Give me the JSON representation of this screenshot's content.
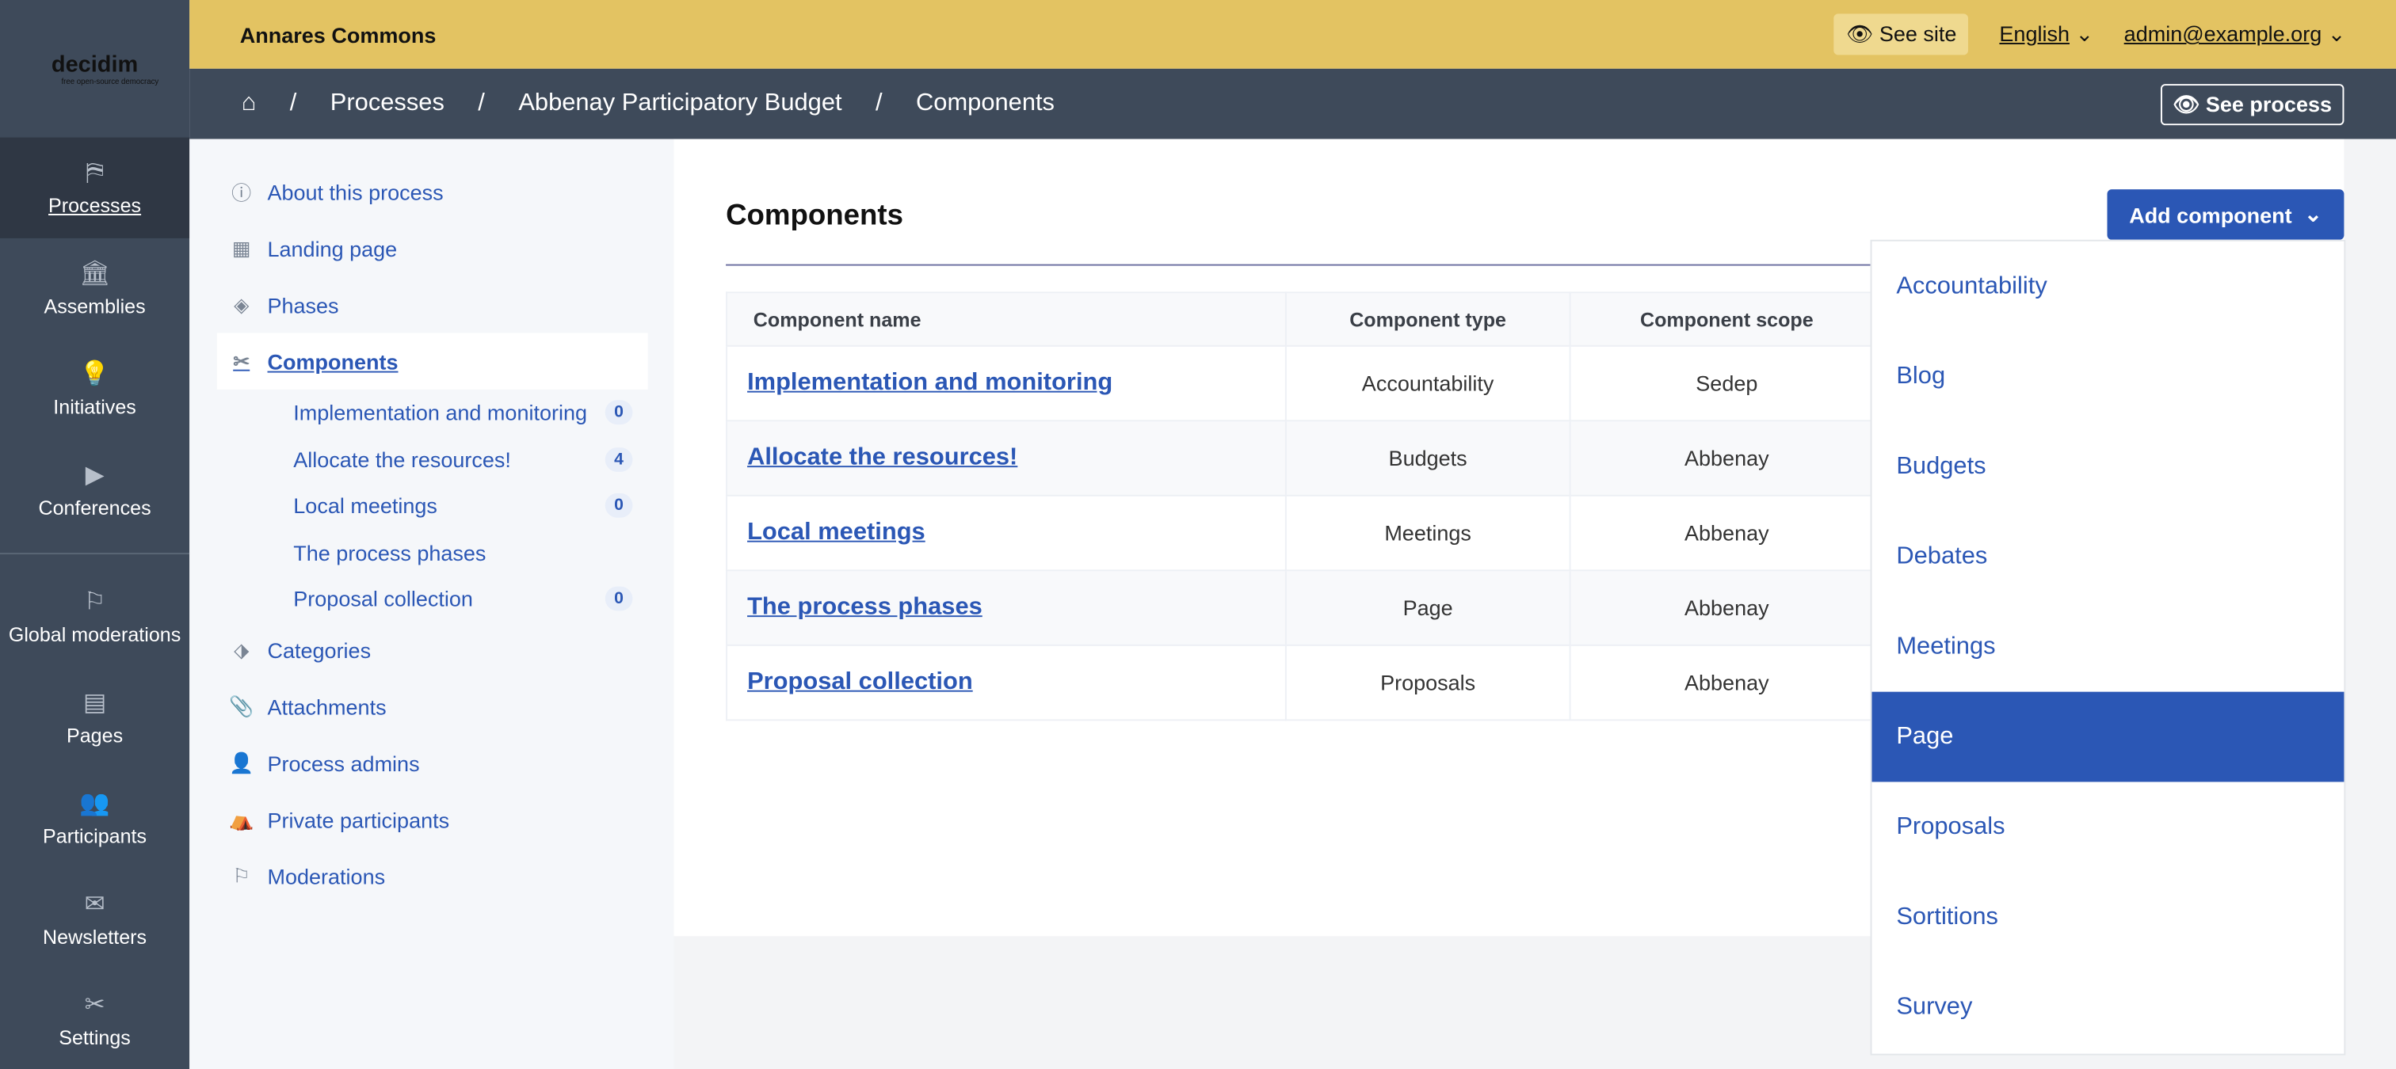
{
  "logo": {
    "text": "decidim",
    "tagline": "free open-source democracy"
  },
  "sidebar": {
    "items": [
      {
        "label": "Processes",
        "icon": "process-icon",
        "active": true
      },
      {
        "label": "Assemblies",
        "icon": "assembly-icon"
      },
      {
        "label": "Initiatives",
        "icon": "lightbulb-icon"
      },
      {
        "label": "Conferences",
        "icon": "video-icon"
      },
      {
        "label": "Global moderations",
        "icon": "flag-icon"
      },
      {
        "label": "Pages",
        "icon": "page-icon"
      },
      {
        "label": "Participants",
        "icon": "people-icon"
      },
      {
        "label": "Newsletters",
        "icon": "mail-icon"
      },
      {
        "label": "Settings",
        "icon": "tools-icon"
      }
    ]
  },
  "topbar": {
    "org": "Annares Commons",
    "see_site": "See site",
    "language": "English",
    "user": "admin@example.org"
  },
  "breadcrumb": {
    "items": [
      "Processes",
      "Abbenay Participatory Budget",
      "Components"
    ],
    "see_process": "See process"
  },
  "subnav": {
    "items": [
      {
        "label": "About this process",
        "icon": "info-icon"
      },
      {
        "label": "Landing page",
        "icon": "layout-icon"
      },
      {
        "label": "Phases",
        "icon": "phases-icon"
      },
      {
        "label": "Components",
        "icon": "tools-icon",
        "active": true
      },
      {
        "label": "Categories",
        "icon": "tag-icon"
      },
      {
        "label": "Attachments",
        "icon": "paperclip-icon"
      },
      {
        "label": "Process admins",
        "icon": "user-settings-icon"
      },
      {
        "label": "Private participants",
        "icon": "private-icon"
      },
      {
        "label": "Moderations",
        "icon": "flag-icon"
      }
    ],
    "children": [
      {
        "label": "Implementation and monitoring",
        "count": "0"
      },
      {
        "label": "Allocate the resources!",
        "count": "4"
      },
      {
        "label": "Local meetings",
        "count": "0"
      },
      {
        "label": "The process phases",
        "count": null
      },
      {
        "label": "Proposal collection",
        "count": "0"
      }
    ]
  },
  "main": {
    "title": "Components",
    "add_button": "Add component",
    "columns": [
      "Component name",
      "Component type",
      "Component scope"
    ],
    "rows": [
      [
        "Implementation and monitoring",
        "Accountability",
        "Sedep"
      ],
      [
        "Allocate the resources!",
        "Budgets",
        "Abbenay"
      ],
      [
        "Local meetings",
        "Meetings",
        "Abbenay"
      ],
      [
        "The process phases",
        "Page",
        "Abbenay"
      ],
      [
        "Proposal collection",
        "Proposals",
        "Abbenay"
      ]
    ]
  },
  "dropdown": {
    "items": [
      "Accountability",
      "Blog",
      "Budgets",
      "Debates",
      "Meetings",
      "Page",
      "Proposals",
      "Sortitions",
      "Survey"
    ],
    "selected": "Page"
  },
  "colors": {
    "accent": "#2b57b5",
    "topbar": "#e3c362",
    "sidebar": "#3e4a5a"
  }
}
